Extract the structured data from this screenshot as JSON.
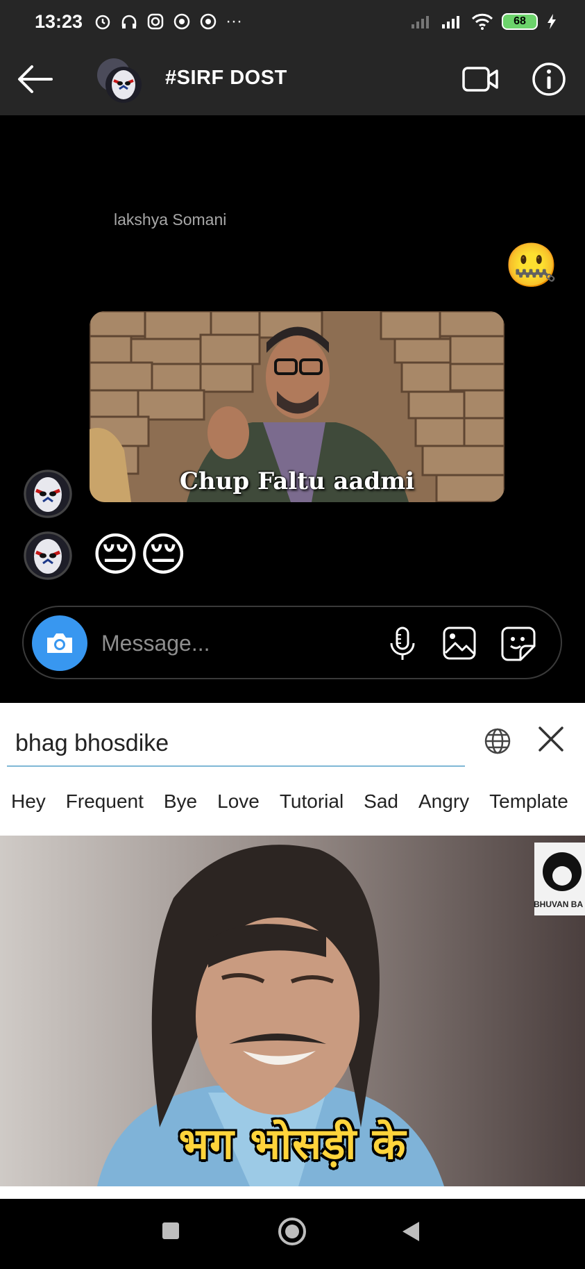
{
  "status_bar": {
    "time": "13:23",
    "battery": "68",
    "more": "···"
  },
  "header": {
    "title": "#SIRF DOST"
  },
  "chat": {
    "sender_name": "lakshya Somani",
    "reaction_emoji": "🤐",
    "gif_caption": "Chup Faltu aadmi",
    "reply_emojis": "😔😔"
  },
  "composer": {
    "placeholder": "Message..."
  },
  "gif_search": {
    "query": "bhag bhosdike",
    "categories": [
      "Hey",
      "Frequent",
      "Bye",
      "Love",
      "Tutorial",
      "Sad",
      "Angry",
      "Template"
    ],
    "result_caption": "भग भोसड़ी के",
    "watermark": "BHUVAN BA"
  },
  "colors": {
    "accent": "#3897f0",
    "header_bg": "#262626",
    "underline": "#7fb8d6"
  }
}
